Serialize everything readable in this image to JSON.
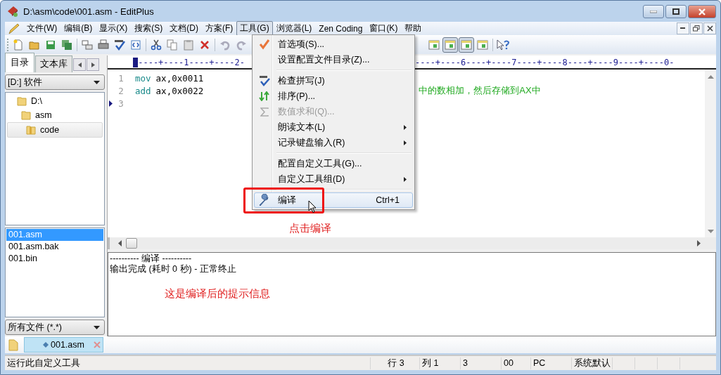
{
  "window": {
    "title": "D:\\asm\\code\\001.asm - EditPlus"
  },
  "menu_bar": [
    {
      "label": "文件(W)",
      "selected": false
    },
    {
      "label": "编辑(B)",
      "selected": false
    },
    {
      "label": "显示(X)",
      "selected": false
    },
    {
      "label": "搜索(S)",
      "selected": false
    },
    {
      "label": "文档(D)",
      "selected": false
    },
    {
      "label": "方案(F)",
      "selected": false
    },
    {
      "label": "工具(G)",
      "selected": true
    },
    {
      "label": "浏览器(L)",
      "selected": false
    },
    {
      "label": "Zen Coding",
      "selected": false
    },
    {
      "label": "窗口(K)",
      "selected": false
    },
    {
      "label": "帮助",
      "selected": false
    }
  ],
  "toolbar": {
    "right_buttons": [
      {
        "pressed": false
      },
      {
        "pressed": true
      },
      {
        "pressed": true
      },
      {
        "pressed": false
      }
    ]
  },
  "sidebar": {
    "tabs": [
      {
        "label": "目录",
        "selected": true
      },
      {
        "label": "文本库",
        "selected": false
      }
    ],
    "drive": "[D:] 软件",
    "tree": [
      {
        "label": "D:\\",
        "selected": false,
        "children": [
          {
            "label": "asm",
            "selected": false,
            "children": [
              {
                "label": "code",
                "selected": true
              }
            ]
          }
        ]
      }
    ],
    "files": [
      {
        "name": "001.asm",
        "selected": true
      },
      {
        "name": "001.asm.bak",
        "selected": false
      },
      {
        "name": "001.bin",
        "selected": false
      }
    ],
    "filter": "所有文件 (*.*)"
  },
  "editor": {
    "ruler_left": "-----+----1----+----2-",
    "ruler_right": "----+----6----+----7----+----8----+----9----+----0-",
    "lines": [
      {
        "number": "1",
        "mnemonic": "mov",
        "operands": "ax,0x0011",
        "current": false
      },
      {
        "number": "2",
        "mnemonic": "add",
        "operands": "ax,0x0022",
        "comment": "中的数相加，然后存储到AX中",
        "current": false
      },
      {
        "number": "3",
        "current": true
      }
    ]
  },
  "output": {
    "lines": [
      "---------- 编译 ----------",
      "输出完成 (耗时 0 秒) - 正常终止"
    ],
    "note": "这是编译后的提示信息"
  },
  "document_tabs": [
    {
      "label": "001.asm",
      "selected": true,
      "modified": true
    }
  ],
  "dropdown_menu": [
    {
      "kind": "item",
      "label": "首选项(S)...",
      "disabled": false,
      "submenu": false,
      "highlighted": false
    },
    {
      "kind": "item",
      "label": "设置配置文件目录(Z)...",
      "disabled": false,
      "submenu": false,
      "highlighted": false
    },
    {
      "kind": "separator"
    },
    {
      "kind": "item",
      "label": "检查拼写(J)",
      "disabled": false,
      "submenu": false,
      "highlighted": false
    },
    {
      "kind": "item",
      "label": "排序(P)...",
      "disabled": false,
      "submenu": false,
      "highlighted": false
    },
    {
      "kind": "item",
      "label": "数值求和(Q)...",
      "disabled": true,
      "submenu": false,
      "highlighted": false
    },
    {
      "kind": "item",
      "label": "朗读文本(L)",
      "disabled": false,
      "submenu": true,
      "highlighted": false
    },
    {
      "kind": "item",
      "label": "记录键盘输入(R)",
      "disabled": false,
      "submenu": true,
      "highlighted": false
    },
    {
      "kind": "separator"
    },
    {
      "kind": "item",
      "label": "配置自定义工具(G)...",
      "disabled": false,
      "submenu": false,
      "highlighted": false
    },
    {
      "kind": "item",
      "label": "自定义工具组(D)",
      "disabled": false,
      "submenu": true,
      "highlighted": false
    },
    {
      "kind": "separator"
    },
    {
      "kind": "item",
      "label": "编译",
      "shortcut": "Ctrl+1",
      "disabled": false,
      "submenu": false,
      "highlighted": true
    }
  ],
  "annotations": {
    "menu_note": "点击编译"
  },
  "status_bar": [
    "运行此自定义工具",
    "行 3",
    "列 1",
    "3",
    "00",
    "PC",
    "系统默认"
  ]
}
